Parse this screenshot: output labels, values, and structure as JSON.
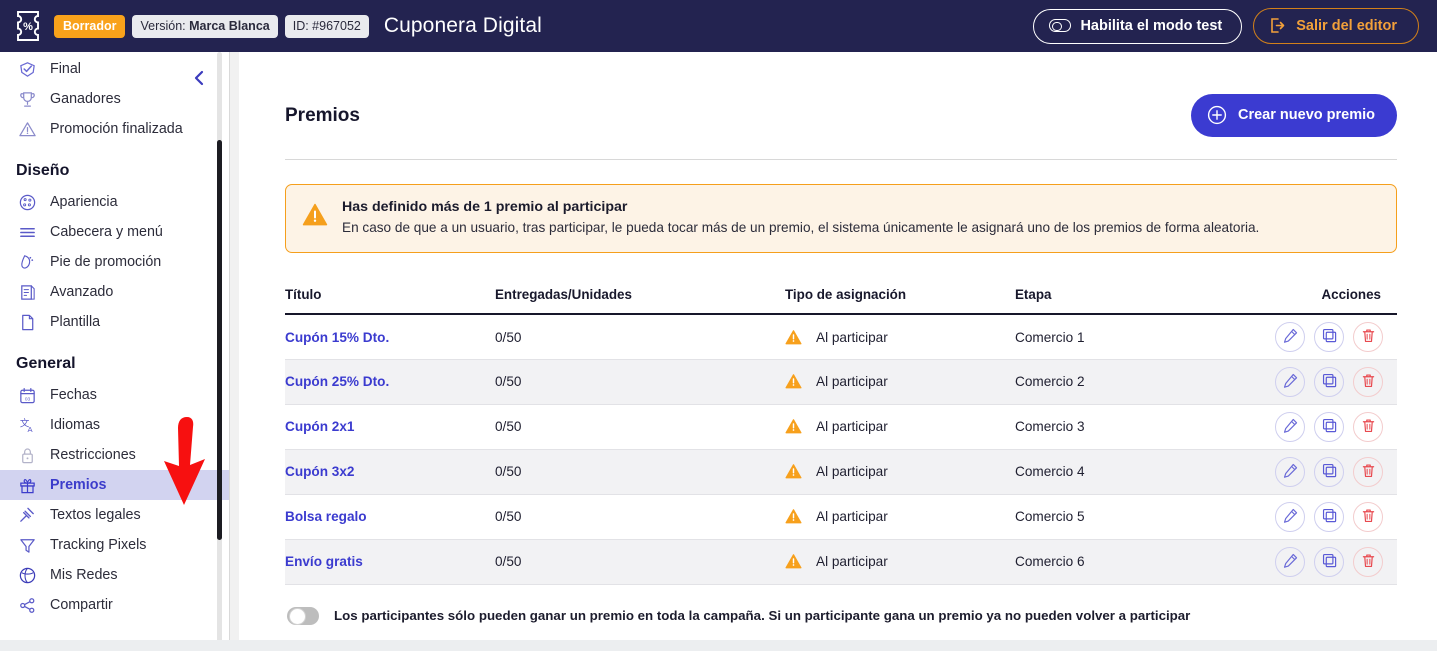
{
  "header": {
    "logo_icon": "coupon-percent-icon",
    "status_badge": "Borrador",
    "version_prefix": "Versión: ",
    "version_value": "Marca Blanca",
    "id_badge": "ID: #967052",
    "app_title": "Cuponera Digital",
    "test_mode_label": "Habilita el modo test",
    "exit_editor_label": "Salir del editor",
    "bg_color": "#232350",
    "draft_badge_color": "#f9a21b",
    "exit_accent_color": "#f2a03a"
  },
  "sidebar": {
    "items_top": [
      {
        "label": "Final",
        "icon": "check-badge-icon",
        "active": false
      },
      {
        "label": "Ganadores",
        "icon": "trophy-icon",
        "active": false
      },
      {
        "label": "Promoción finalizada",
        "icon": "warning-triangle-icon",
        "active": false
      }
    ],
    "group_diseno": "Diseño",
    "items_diseno": [
      {
        "label": "Apariencia",
        "icon": "palette-icon",
        "active": false
      },
      {
        "label": "Cabecera y menú",
        "icon": "menu-lines-icon",
        "active": false
      },
      {
        "label": "Pie de promoción",
        "icon": "footer-icon",
        "active": false
      },
      {
        "label": "Avanzado",
        "icon": "document-settings-icon",
        "active": false
      },
      {
        "label": "Plantilla",
        "icon": "page-icon",
        "active": false
      }
    ],
    "group_general": "General",
    "items_general": [
      {
        "label": "Fechas",
        "icon": "calendar-icon",
        "active": false
      },
      {
        "label": "Idiomas",
        "icon": "translate-icon",
        "active": false
      },
      {
        "label": "Restricciones",
        "icon": "lock-icon",
        "active": false
      },
      {
        "label": "Premios",
        "icon": "gift-icon",
        "active": true
      },
      {
        "label": "Textos legales",
        "icon": "gavel-icon",
        "active": false
      },
      {
        "label": "Tracking Pixels",
        "icon": "funnel-icon",
        "active": false
      },
      {
        "label": "Mis Redes",
        "icon": "globe-icon",
        "active": false
      },
      {
        "label": "Compartir",
        "icon": "share-icon",
        "active": false
      }
    ],
    "collapse_icon": "chevron-left-icon",
    "active_bg_color": "#d2d3f0",
    "active_text_color": "#3c3ccb"
  },
  "annotation": {
    "arrow_icon": "red-down-arrow-annotation",
    "color": "#f71010"
  },
  "main": {
    "page_title": "Premios",
    "create_button": {
      "label": "Crear nuevo premio",
      "icon": "plus-circle-icon",
      "color": "#3b3bd1"
    },
    "alert": {
      "icon": "warning-triangle-icon",
      "title": "Has definido más de 1 premio al participar",
      "body": "En caso de que a un usuario, tras participar, le pueda tocar más de un premio, el sistema únicamente le asignará uno de los premios de forma aleatoria.",
      "border_color": "#f59f1c",
      "bg_color": "#fdf3e6"
    },
    "table": {
      "columns": [
        "Título",
        "Entregadas/Unidades",
        "Tipo de asignación",
        "Etapa",
        "Acciones"
      ],
      "rows": [
        {
          "titulo": "Cupón 15% Dto.",
          "entregadas": "0/50",
          "tipo": "Al participar",
          "tipo_icon": "warning-triangle-icon",
          "etapa": "Comercio 1"
        },
        {
          "titulo": "Cupón 25% Dto.",
          "entregadas": "0/50",
          "tipo": "Al participar",
          "tipo_icon": "warning-triangle-icon",
          "etapa": "Comercio 2"
        },
        {
          "titulo": "Cupón 2x1",
          "entregadas": "0/50",
          "tipo": "Al participar",
          "tipo_icon": "warning-triangle-icon",
          "etapa": "Comercio 3"
        },
        {
          "titulo": "Cupón 3x2",
          "entregadas": "0/50",
          "tipo": "Al participar",
          "tipo_icon": "warning-triangle-icon",
          "etapa": "Comercio 4"
        },
        {
          "titulo": "Bolsa regalo",
          "entregadas": "0/50",
          "tipo": "Al participar",
          "tipo_icon": "warning-triangle-icon",
          "etapa": "Comercio 5"
        },
        {
          "titulo": "Envío gratis",
          "entregadas": "0/50",
          "tipo": "Al participar",
          "tipo_icon": "warning-triangle-icon",
          "etapa": "Comercio 6"
        }
      ],
      "row_actions": [
        {
          "name": "edit",
          "icon": "pencil-icon"
        },
        {
          "name": "duplicate",
          "icon": "copy-icon"
        },
        {
          "name": "delete",
          "icon": "trash-icon"
        }
      ],
      "link_color": "#3b3bcf"
    },
    "bottom_toggle": {
      "state": "off",
      "label": "Los participantes sólo pueden ganar un premio en toda la campaña. Si un participante gana un premio ya no pueden volver a participar"
    }
  }
}
